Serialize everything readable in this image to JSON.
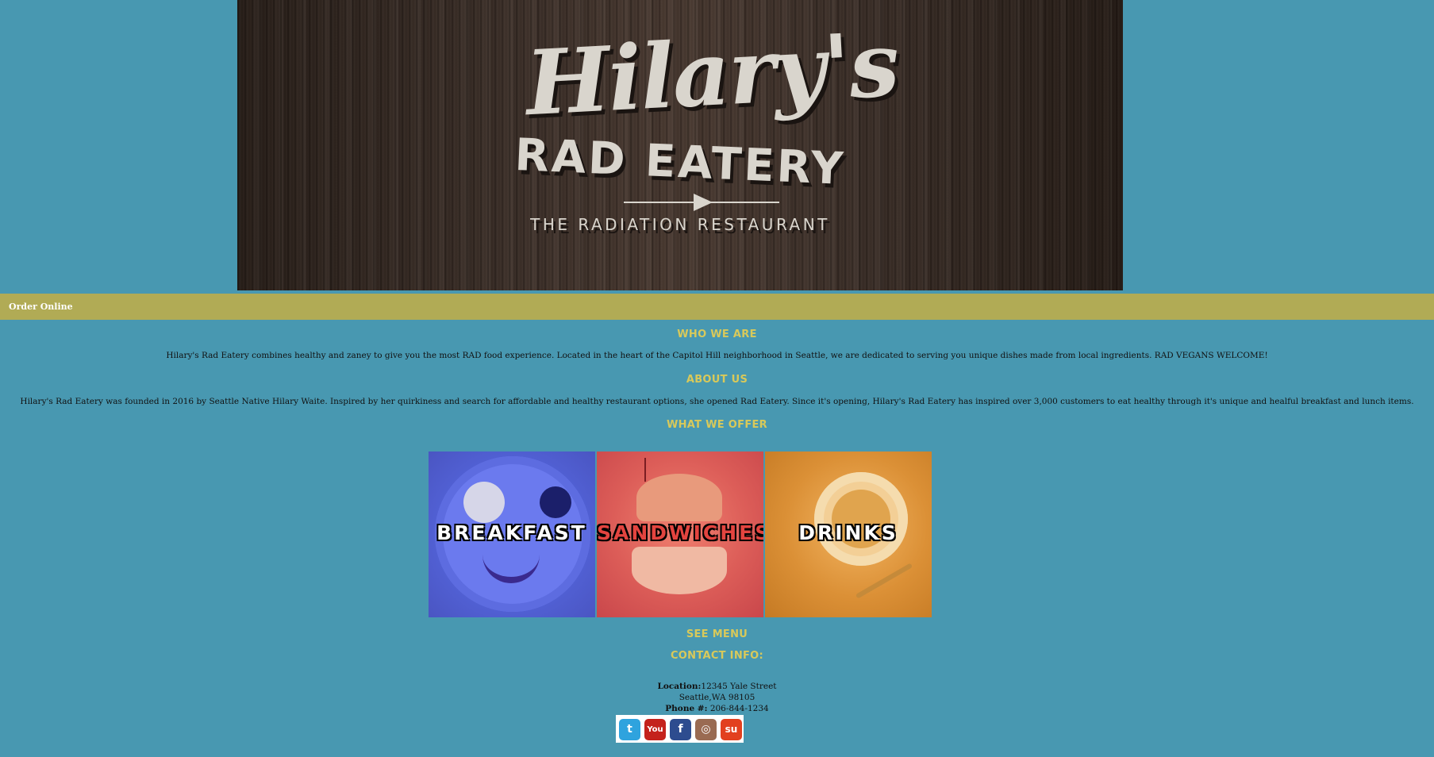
{
  "banner": {
    "script_title": "Hilary's",
    "main_title": "RAD EATERY",
    "tagline": "THE RADIATION RESTAURANT"
  },
  "nav": {
    "order_online": "Order Online"
  },
  "who": {
    "heading": "WHO WE ARE",
    "text": "Hilary's Rad Eatery combines healthy and zaney to give you the most RAD food experience. Located in the heart of the Capitol Hill neighborhood in Seattle, we are dedicated to serving you unique dishes made from local ingredients. RAD VEGANS WELCOME!"
  },
  "about": {
    "heading": "ABOUT US",
    "text": "Hilary's Rad Eatery was founded in 2016 by Seattle Native Hilary Waite. Inspired by her quirkiness and search for affordable and healthy restaurant options, she opened Rad Eatery. Since it's opening, Hilary's Rad Eatery has inspired over 3,000 customers to eat healthy through it's unique and healful breakfast and lunch items."
  },
  "offer": {
    "heading": "WHAT WE OFFER",
    "tiles": [
      {
        "label": "BREAKFAST",
        "color": "#5363d8"
      },
      {
        "label": "SANDWICHES",
        "color": "#dc5d58"
      },
      {
        "label": "DRINKS",
        "color": "#db9036"
      }
    ]
  },
  "see_menu": "SEE MENU",
  "contact": {
    "heading": "CONTACT INFO:",
    "location_label": "Location:",
    "location_street": "12345 Yale Street",
    "location_city": "Seattle,WA 98105",
    "phone_label": "Phone #:",
    "phone_value": "206-844-1234"
  },
  "social": [
    {
      "name": "twitter-icon",
      "glyph": "t",
      "color": "#2fa3de"
    },
    {
      "name": "youtube-icon",
      "glyph": "You",
      "color": "#c4221c"
    },
    {
      "name": "facebook-icon",
      "glyph": "f",
      "color": "#2d4c8f"
    },
    {
      "name": "instagram-icon",
      "glyph": "◎",
      "color": "#9a6b52"
    },
    {
      "name": "stumbleupon-icon",
      "glyph": "su",
      "color": "#e2401f"
    }
  ],
  "colors": {
    "background": "#4898b1",
    "navbar": "#b1ab55",
    "heading": "#d8c95a"
  }
}
